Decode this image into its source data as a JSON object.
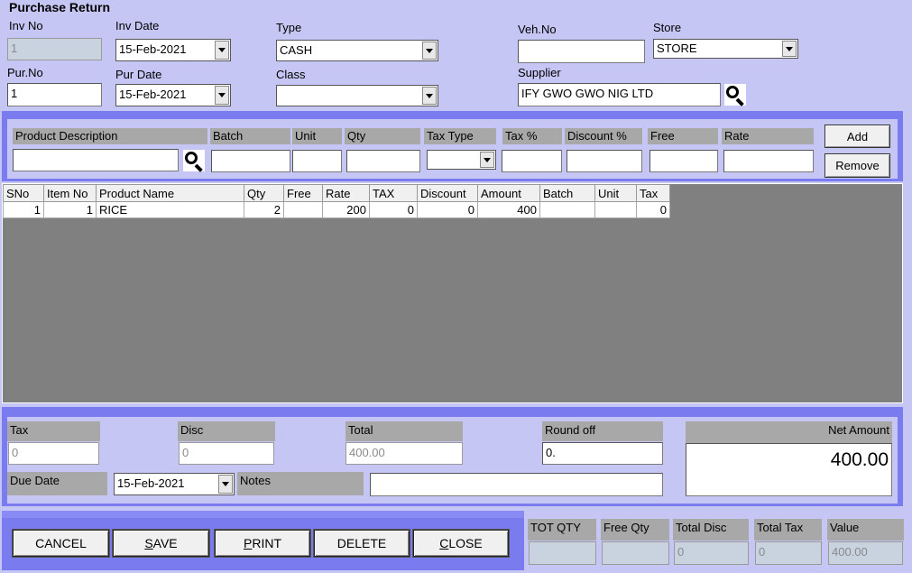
{
  "title": "Purchase Return",
  "header": {
    "inv_no": {
      "label": "Inv No",
      "value": "1"
    },
    "inv_date": {
      "label": "Inv Date",
      "value": "15-Feb-2021"
    },
    "type": {
      "label": "Type",
      "value": "CASH"
    },
    "veh_no": {
      "label": "Veh.No",
      "value": ""
    },
    "store": {
      "label": "Store",
      "value": "STORE"
    },
    "pur_no": {
      "label": "Pur.No",
      "value": "1"
    },
    "pur_date": {
      "label": "Pur Date",
      "value": "15-Feb-2021"
    },
    "class": {
      "label": "Class",
      "value": ""
    },
    "supplier": {
      "label": "Supplier",
      "value": "IFY GWO GWO NIG LTD"
    }
  },
  "entry": {
    "product_description": "Product Description",
    "batch": "Batch",
    "unit": "Unit",
    "qty": "Qty",
    "tax_type": "Tax Type",
    "tax_pct": "Tax %",
    "discount_pct": "Discount %",
    "free": "Free",
    "rate": "Rate",
    "add_label": "Add",
    "remove_label": "Remove"
  },
  "grid": {
    "columns": [
      "SNo",
      "Item No",
      "Product Name",
      "Qty",
      "Free",
      "Rate",
      "TAX",
      "Discount",
      "Amount",
      "Batch",
      "Unit",
      "Tax"
    ],
    "rows": [
      [
        "1",
        "1",
        "RICE",
        "2",
        "",
        "200",
        "0",
        "0",
        "400",
        "",
        "",
        "0"
      ]
    ]
  },
  "totals": {
    "tax": {
      "label": "Tax",
      "value": "0"
    },
    "disc": {
      "label": "Disc",
      "value": "0"
    },
    "total": {
      "label": "Total",
      "value": "400.00"
    },
    "round_off": {
      "label": "Round off",
      "value": "0."
    },
    "net_amount": {
      "label": "Net Amount",
      "value": "400.00"
    },
    "due_date": {
      "label": "Due Date",
      "value": "15-Feb-2021"
    },
    "notes": {
      "label": "Notes",
      "value": ""
    }
  },
  "actions": {
    "cancel": "CANCEL",
    "save_first": "S",
    "save_rest": "AVE",
    "print_first": "P",
    "print_rest": "RINT",
    "delete": "DELETE",
    "close_first": "C",
    "close_rest": "LOSE"
  },
  "summary": {
    "tot_qty": {
      "label": "TOT QTY",
      "value": ""
    },
    "free_qty": {
      "label": "Free Qty",
      "value": ""
    },
    "total_disc": {
      "label": "Total Disc",
      "value": "0"
    },
    "total_tax": {
      "label": "Total Tax",
      "value": "0"
    },
    "value": {
      "label": "Value",
      "value": "400.00"
    }
  },
  "colors": {
    "background": "#c6c6f5",
    "panel": "#7b7bf0",
    "grid_bg": "#808080",
    "header_cell": "#a8a8a8"
  }
}
